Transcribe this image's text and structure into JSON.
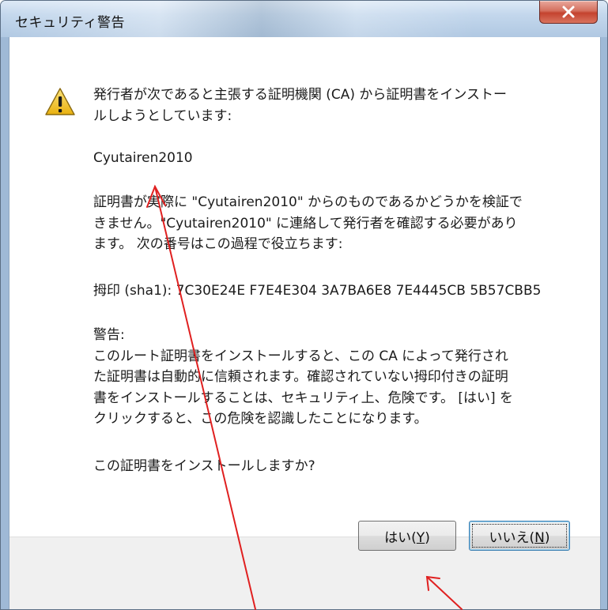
{
  "window": {
    "title": "セキュリティ警告",
    "close_symbol": "x"
  },
  "icons": {
    "warning": "warning-triangle-icon",
    "close": "close-icon"
  },
  "message": {
    "intro_line1": "発行者が次であると主張する証明機関 (CA) から証明書をインストー",
    "intro_line2": "ルしようとしています:",
    "issuer": "Cyutairen2010",
    "verify_line1": "証明書が実際に \"Cyutairen2010\" からのものであるかどうかを検証で",
    "verify_line2": "きません。\"Cyutairen2010\" に連絡して発行者を確認する必要があり",
    "verify_line3": "ます。 次の番号はこの過程で役立ちます:",
    "thumbprint": "拇印 (sha1): 7C30E24E F7E4E304 3A7BA6E8 7E4445CB 5B57CBB5",
    "warning_heading": "警告:",
    "warning_line1": "このルート証明書をインストールすると、この CA によって発行され",
    "warning_line2": "た証明書は自動的に信頼されます。確認されていない拇印付きの証明",
    "warning_line3": "書をインストールすることは、セキュリティ上、危険です。 [はい] を",
    "warning_line4": "クリックすると、この危険を認識したことになります。",
    "question": "この証明書をインストールしますか?"
  },
  "buttons": {
    "yes_text": "はい(",
    "yes_key": "Y",
    "yes_close": ")",
    "no_text": "いいえ(",
    "no_key": "N",
    "no_close": ")"
  },
  "colors": {
    "annotation_arrow": "#e02020",
    "close_button": "#c4432f",
    "warning_yellow": "#f3c623"
  }
}
